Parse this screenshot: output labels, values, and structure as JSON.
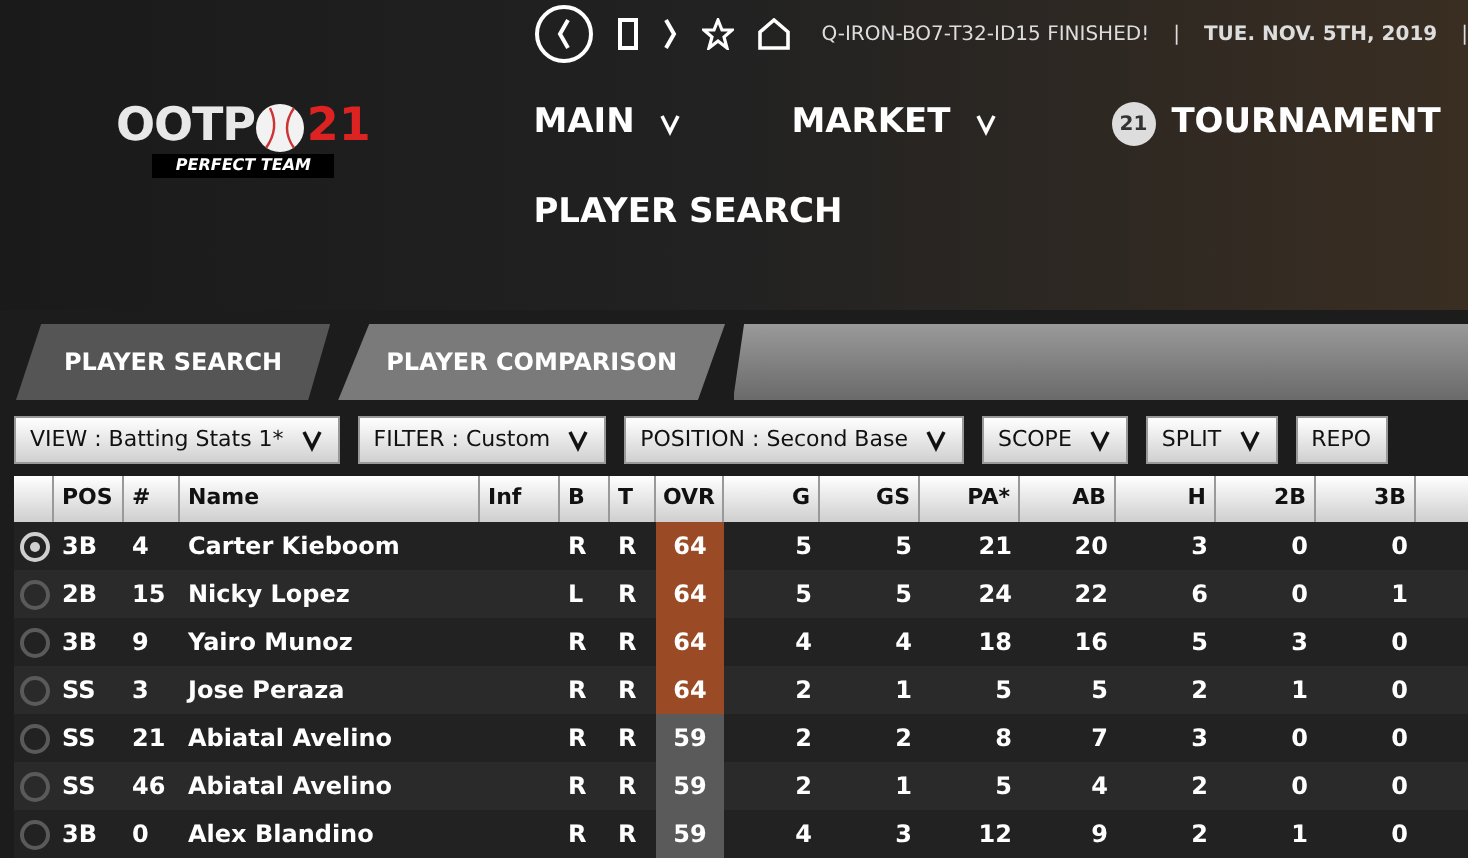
{
  "top_bar": {
    "status": "Q-IRON-BO7-T32-ID15 FINISHED!",
    "date": "TUE. NOV. 5TH, 2019",
    "separator": "|"
  },
  "logo": {
    "name": "OOTP",
    "number": "21",
    "tagline": "PERFECT TEAM"
  },
  "nav": [
    {
      "label": "MAIN",
      "kind": "menu"
    },
    {
      "label": "MARKET",
      "kind": "menu"
    },
    {
      "label": "TOURNAMENT",
      "kind": "badge",
      "badge": "21"
    }
  ],
  "page_title": "PLAYER SEARCH",
  "tabs": [
    {
      "label": "PLAYER SEARCH",
      "selected": true
    },
    {
      "label": "PLAYER COMPARISON",
      "selected": false
    }
  ],
  "filters": [
    {
      "label": "VIEW : Batting Stats 1*"
    },
    {
      "label": "FILTER : Custom"
    },
    {
      "label": "POSITION : Second Base"
    },
    {
      "label": "SCOPE"
    },
    {
      "label": "SPLIT"
    },
    {
      "label": "REPO"
    }
  ],
  "table": {
    "columns": [
      "POS",
      "#",
      "Name",
      "Inf",
      "B",
      "T",
      "OVR",
      "G",
      "GS",
      "PA*",
      "AB",
      "H",
      "2B",
      "3B"
    ],
    "rows": [
      {
        "selected": true,
        "color": "#9a4a24",
        "cells": [
          "3B",
          "4",
          "Carter Kieboom",
          "",
          "R",
          "R",
          "64",
          "5",
          "5",
          "21",
          "20",
          "3",
          "0",
          "0"
        ]
      },
      {
        "selected": false,
        "color": "#9a4a24",
        "cells": [
          "2B",
          "15",
          "Nicky Lopez",
          "",
          "L",
          "R",
          "64",
          "5",
          "5",
          "24",
          "22",
          "6",
          "0",
          "1"
        ]
      },
      {
        "selected": false,
        "color": "#9a4a24",
        "cells": [
          "3B",
          "9",
          "Yairo Munoz",
          "",
          "R",
          "R",
          "64",
          "4",
          "4",
          "18",
          "16",
          "5",
          "3",
          "0"
        ]
      },
      {
        "selected": false,
        "color": "#9a4a24",
        "cells": [
          "SS",
          "3",
          "Jose Peraza",
          "",
          "R",
          "R",
          "64",
          "2",
          "1",
          "5",
          "5",
          "2",
          "1",
          "0"
        ]
      },
      {
        "selected": false,
        "color": "#5a5a5a",
        "cells": [
          "SS",
          "21",
          "Abiatal Avelino",
          "",
          "R",
          "R",
          "59",
          "2",
          "2",
          "8",
          "7",
          "3",
          "0",
          "0"
        ]
      },
      {
        "selected": false,
        "color": "#5a5a5a",
        "cells": [
          "SS",
          "46",
          "Abiatal Avelino",
          "",
          "R",
          "R",
          "59",
          "2",
          "1",
          "5",
          "4",
          "2",
          "0",
          "0"
        ]
      },
      {
        "selected": false,
        "color": "#5a5a5a",
        "cells": [
          "3B",
          "0",
          "Alex Blandino",
          "",
          "R",
          "R",
          "59",
          "4",
          "3",
          "12",
          "9",
          "2",
          "1",
          "0"
        ]
      }
    ]
  }
}
